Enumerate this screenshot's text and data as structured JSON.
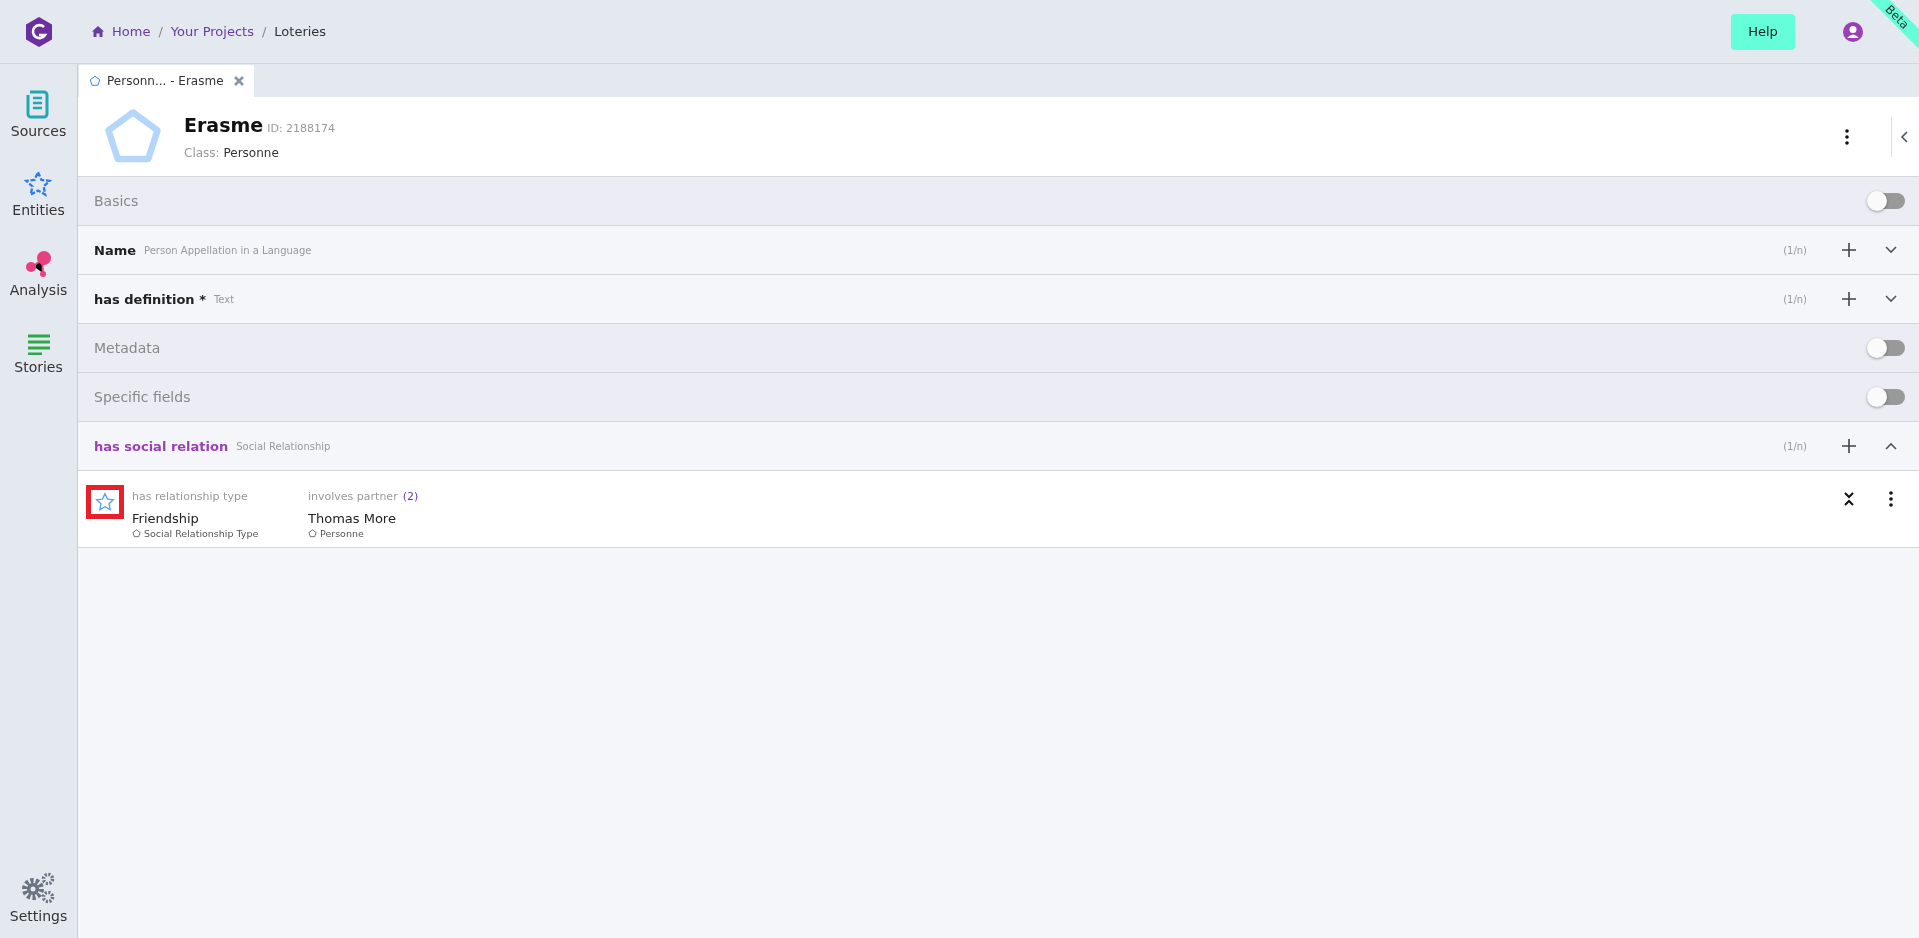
{
  "breadcrumb": [
    {
      "label": "Home",
      "link": true
    },
    {
      "separator": "/",
      "label": "Your Projects",
      "link": true
    },
    {
      "separator": "/",
      "label": "Loteries",
      "link": false
    }
  ],
  "help_button": "Help",
  "ribbon": "Beta",
  "sidebar": {
    "items": [
      {
        "kind": "sources",
        "label": "Sources"
      },
      {
        "kind": "entities",
        "label": "Entities"
      },
      {
        "kind": "analysis",
        "label": "Analysis"
      },
      {
        "kind": "stories",
        "label": "Stories"
      }
    ],
    "settings": "Settings"
  },
  "tabs": [
    {
      "label": "Personn... - Erasme",
      "selected": true
    }
  ],
  "entity": {
    "name": "Erasme",
    "id": "ID: 2188174",
    "class_label": "Class:",
    "class_value": "Personne"
  },
  "sections": [
    {
      "kind": "toggle",
      "label": "Basics",
      "on": false
    },
    {
      "kind": "field",
      "label": "Name",
      "sublabel": "Person Appellation in a Language",
      "count": "(1/n)",
      "expanded": false
    },
    {
      "kind": "field",
      "label": "has definition *",
      "sublabel": "Text",
      "count": "(1/n)",
      "expanded": false
    },
    {
      "kind": "toggle",
      "label": "Metadata",
      "on": false
    },
    {
      "kind": "toggle",
      "label": "Specific fields",
      "on": false
    },
    {
      "kind": "field",
      "label": "has social relation",
      "sublabel": "Social Relationship",
      "count": "(1/n)",
      "expanded": true
    }
  ],
  "relation_row": {
    "highlighted": true,
    "columns": [
      {
        "label": "has relationship type",
        "value": "Friendship",
        "class": "Social Relationship Type"
      },
      {
        "label": "involves partner",
        "count": "(2)",
        "value": "Thomas More",
        "class": "Personne"
      }
    ]
  }
}
